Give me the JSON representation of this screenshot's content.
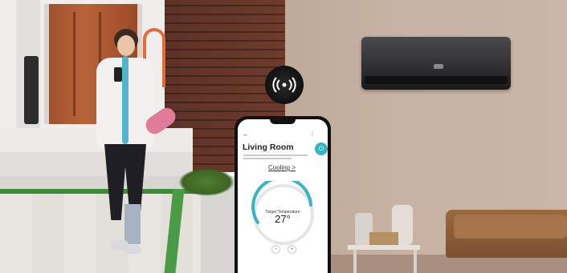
{
  "app": {
    "room_name": "Living Room",
    "mode_label": "Cooling >",
    "gauge_label": "Target Temperature",
    "target_temperature": "27°",
    "accent_color": "#35b4c4"
  },
  "icons": {
    "back": "arrow-left-icon",
    "wifi": "wifi-icon",
    "power": "power-icon",
    "menu": "menu-icon"
  }
}
